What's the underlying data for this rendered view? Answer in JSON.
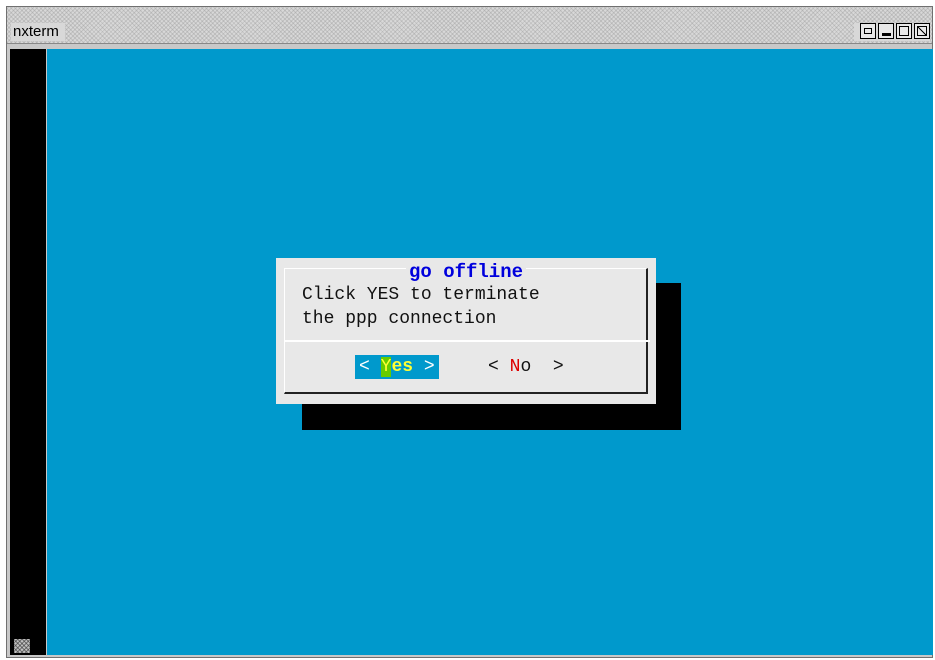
{
  "window": {
    "title": "nxterm"
  },
  "dialog": {
    "title": "go offline",
    "message_line1": "Click YES to terminate",
    "message_line2": "the ppp connection",
    "yes_button": {
      "left_bracket": "<",
      "hotkey": "Y",
      "rest": "es",
      "right_bracket": ">"
    },
    "no_button": {
      "left_bracket": "<",
      "hotkey": "N",
      "rest": "o",
      "right_bracket": ">"
    }
  },
  "colors": {
    "terminal_bg": "#0099cc",
    "dialog_bg": "#e8e8e8",
    "title_color": "#0000dd",
    "hotkey_red": "#dd0000",
    "selected_text": "#ffff33"
  }
}
